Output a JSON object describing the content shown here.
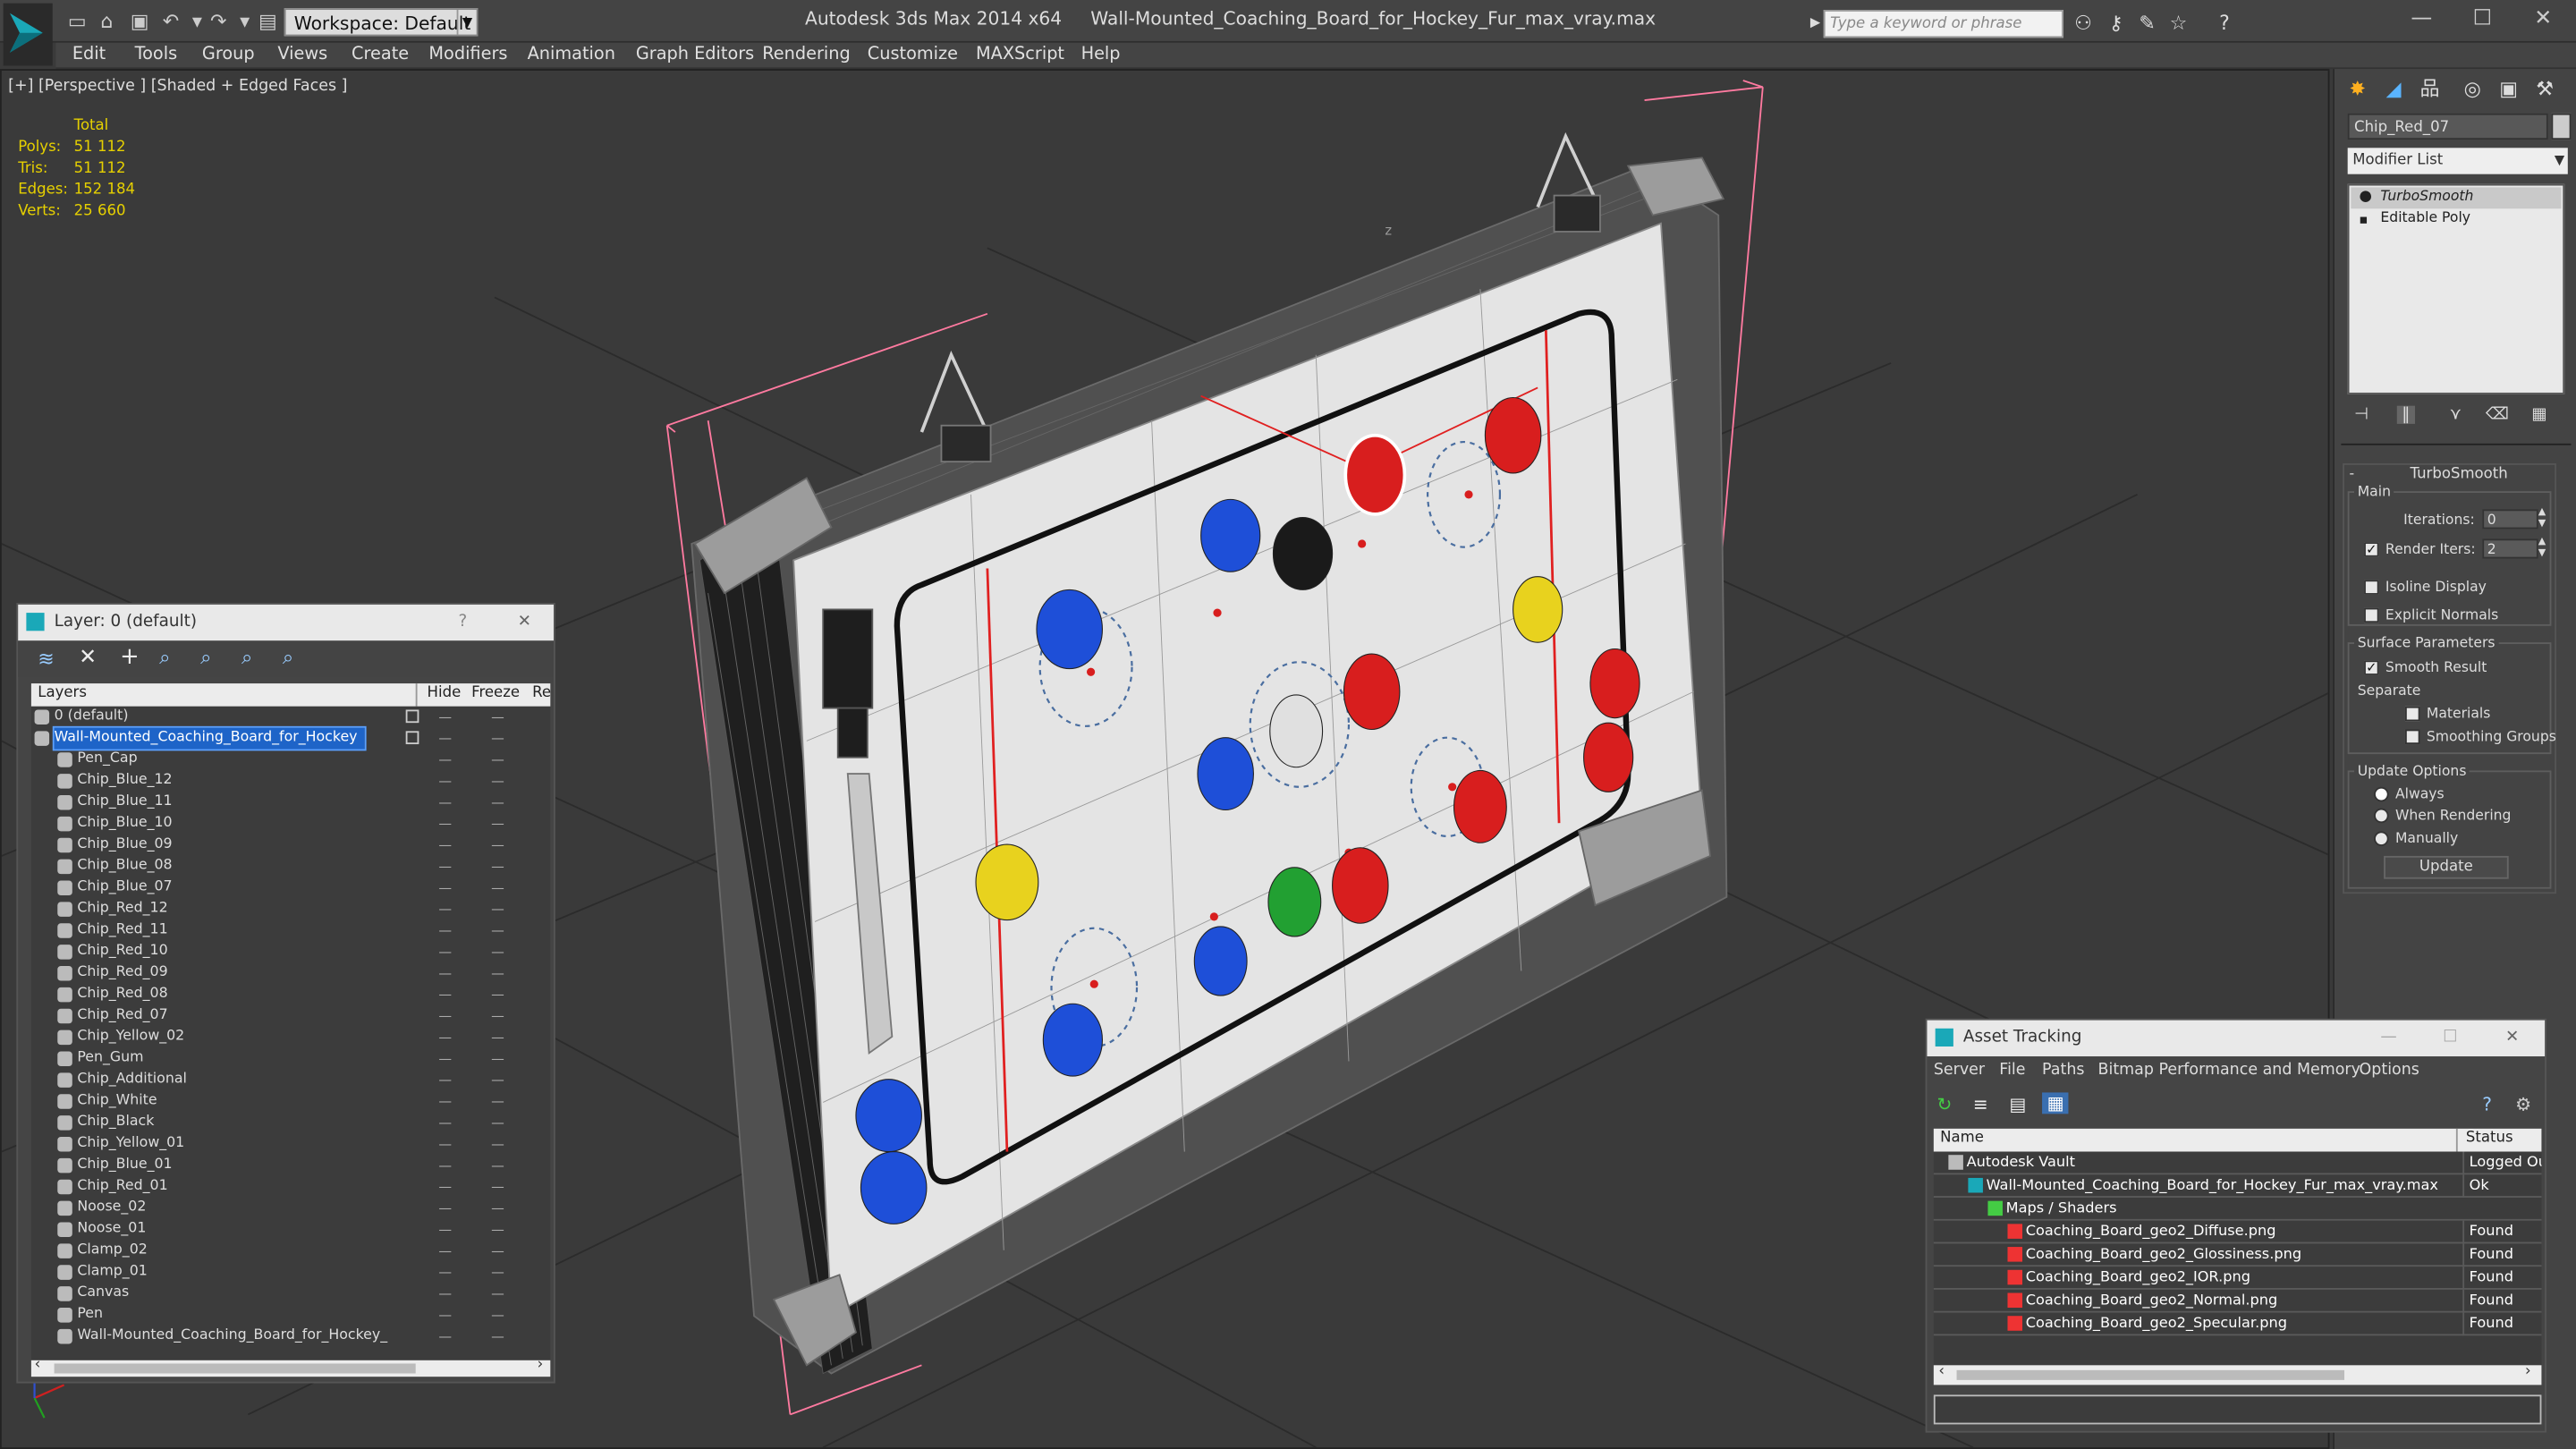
{
  "app": {
    "title": "Autodesk 3ds Max 2014 x64     Wall-Mounted_Coaching_Board_for_Hockey_Fur_max_vray.max",
    "workspace_label": "Workspace: Default",
    "search_placeholder": "Type a keyword or phrase"
  },
  "menu": [
    "Edit",
    "Tools",
    "Group",
    "Views",
    "Create",
    "Modifiers",
    "Animation",
    "Graph Editors",
    "Rendering",
    "Customize",
    "MAXScript",
    "Help"
  ],
  "viewport": {
    "label": "[+] [Perspective ] [Shaded + Edged Faces ]",
    "stats_header": "Total",
    "stats": [
      {
        "label": "Polys:",
        "value": "51 112"
      },
      {
        "label": "Tris:",
        "value": "51 112"
      },
      {
        "label": "Edges:",
        "value": "152 184"
      },
      {
        "label": "Verts:",
        "value": "25 660"
      }
    ],
    "axis_label": "z"
  },
  "layer_panel": {
    "title": "Layer: 0 (default)",
    "help": "?",
    "close": "✕",
    "col_layers": "Layers",
    "col_hide": "Hide",
    "col_freeze": "Freeze",
    "col_render": "Re",
    "rows": [
      {
        "name": "0 (default)",
        "indent": 1
      },
      {
        "name": "Wall-Mounted_Coaching_Board_for_Hockey",
        "indent": 1,
        "selected": true
      },
      {
        "name": "Pen_Cap",
        "indent": 2
      },
      {
        "name": "Chip_Blue_12",
        "indent": 2
      },
      {
        "name": "Chip_Blue_11",
        "indent": 2
      },
      {
        "name": "Chip_Blue_10",
        "indent": 2
      },
      {
        "name": "Chip_Blue_09",
        "indent": 2
      },
      {
        "name": "Chip_Blue_08",
        "indent": 2
      },
      {
        "name": "Chip_Blue_07",
        "indent": 2
      },
      {
        "name": "Chip_Red_12",
        "indent": 2
      },
      {
        "name": "Chip_Red_11",
        "indent": 2
      },
      {
        "name": "Chip_Red_10",
        "indent": 2
      },
      {
        "name": "Chip_Red_09",
        "indent": 2
      },
      {
        "name": "Chip_Red_08",
        "indent": 2
      },
      {
        "name": "Chip_Red_07",
        "indent": 2
      },
      {
        "name": "Chip_Yellow_02",
        "indent": 2
      },
      {
        "name": "Pen_Gum",
        "indent": 2
      },
      {
        "name": "Chip_Additional",
        "indent": 2
      },
      {
        "name": "Chip_White",
        "indent": 2
      },
      {
        "name": "Chip_Black",
        "indent": 2
      },
      {
        "name": "Chip_Yellow_01",
        "indent": 2
      },
      {
        "name": "Chip_Blue_01",
        "indent": 2
      },
      {
        "name": "Chip_Red_01",
        "indent": 2
      },
      {
        "name": "Noose_02",
        "indent": 2
      },
      {
        "name": "Noose_01",
        "indent": 2
      },
      {
        "name": "Clamp_02",
        "indent": 2
      },
      {
        "name": "Clamp_01",
        "indent": 2
      },
      {
        "name": "Canvas",
        "indent": 2
      },
      {
        "name": "Pen",
        "indent": 2
      },
      {
        "name": "Wall-Mounted_Coaching_Board_for_Hockey_",
        "indent": 2
      }
    ]
  },
  "command_panel": {
    "object_name": "Chip_Red_07",
    "modifier_list": "Modifier List",
    "stack": [
      "TurboSmooth",
      "Editable Poly"
    ],
    "rollout_title": "TurboSmooth",
    "main_label": "Main",
    "iterations_label": "Iterations:",
    "iterations_value": "0",
    "render_iters_label": "Render Iters:",
    "render_iters_value": "2",
    "isoline_label": "Isoline Display",
    "explicit_normals_label": "Explicit Normals",
    "surface_params_label": "Surface Parameters",
    "smooth_result_label": "Smooth Result",
    "separate_label": "Separate",
    "materials_label": "Materials",
    "smoothing_groups_label": "Smoothing Groups",
    "update_options_label": "Update Options",
    "always_label": "Always",
    "when_rendering_label": "When Rendering",
    "manually_label": "Manually",
    "update_button": "Update",
    "collapse_sign": "-"
  },
  "asset_panel": {
    "title": "Asset Tracking",
    "menu": [
      "Server",
      "File",
      "Paths",
      "Bitmap Performance and Memory",
      "Options"
    ],
    "col_name": "Name",
    "col_status": "Status",
    "rows": [
      {
        "name": "Autodesk Vault",
        "status": "Logged Ou",
        "indent": 1,
        "icon": "vault"
      },
      {
        "name": "Wall-Mounted_Coaching_Board_for_Hockey_Fur_max_vray.max",
        "status": "Ok",
        "indent": 2,
        "icon": "max"
      },
      {
        "name": "Maps / Shaders",
        "status": "",
        "indent": 3,
        "icon": "maps"
      },
      {
        "name": "Coaching_Board_geo2_Diffuse.png",
        "status": "Found",
        "indent": 4,
        "icon": "png"
      },
      {
        "name": "Coaching_Board_geo2_Glossiness.png",
        "status": "Found",
        "indent": 4,
        "icon": "png"
      },
      {
        "name": "Coaching_Board_geo2_IOR.png",
        "status": "Found",
        "indent": 4,
        "icon": "png"
      },
      {
        "name": "Coaching_Board_geo2_Normal.png",
        "status": "Found",
        "indent": 4,
        "icon": "png"
      },
      {
        "name": "Coaching_Board_geo2_Specular.png",
        "status": "Found",
        "indent": 4,
        "icon": "png"
      }
    ]
  },
  "colors": {
    "selection_blue": "#1e64c8",
    "stats_yellow": "#e6d000",
    "chip_red": "#d81e1e",
    "chip_blue": "#1e4fd8",
    "chip_yellow": "#e8d21e",
    "chip_green": "#22a032",
    "bbox_pink": "#ff7aa0"
  }
}
